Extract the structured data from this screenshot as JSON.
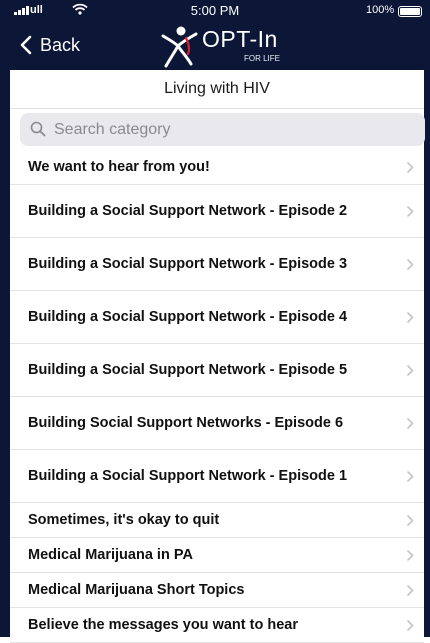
{
  "status_bar": {
    "carrier": "ull",
    "time": "5:00 PM",
    "battery": "100%"
  },
  "header": {
    "back_label": "Back",
    "logo_text": "OPT-In",
    "logo_subtext": "FOR LIFE"
  },
  "page_title": "Living with HIV",
  "search": {
    "placeholder": "Search category",
    "value": ""
  },
  "items": [
    {
      "label": "We want to hear from you!"
    },
    {
      "label": "Building a Social Support Network - Episode 2"
    },
    {
      "label": "Building a Social Support Network - Episode 3"
    },
    {
      "label": "Building a Social Support Network - Episode 4"
    },
    {
      "label": "Building a Social Support Network - Episode 5"
    },
    {
      "label": "Building Social Support Networks - Episode 6"
    },
    {
      "label": "Building a Social Support Network - Episode 1"
    },
    {
      "label": "Sometimes, it's okay to quit"
    },
    {
      "label": "Medical Marijuana in PA"
    },
    {
      "label": "Medical Marijuana Short Topics"
    },
    {
      "label": "Believe the messages you want to hear"
    }
  ],
  "colors": {
    "header_background": "#0c1738",
    "chevron": "#c4c4c9",
    "search_background": "#e9e9ed"
  },
  "icons": [
    "signal-icon",
    "wifi-icon",
    "battery-icon",
    "back-chevron-icon",
    "logo-figure-icon",
    "search-icon",
    "chevron-right-icon"
  ]
}
